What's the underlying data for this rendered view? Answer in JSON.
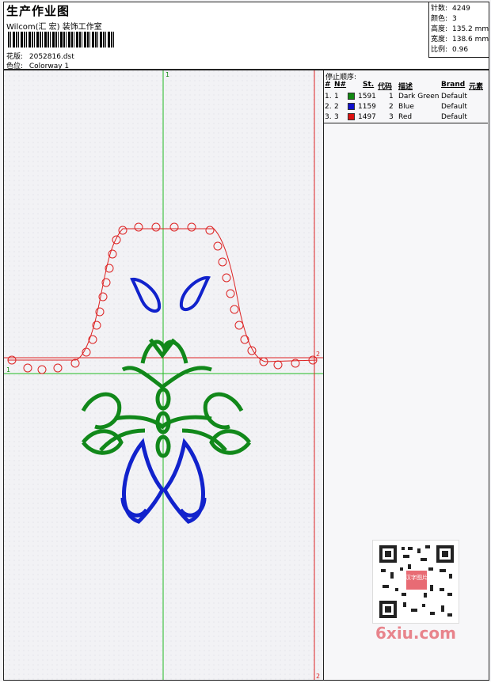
{
  "header": {
    "title": "生产作业图",
    "subtitle": "Wilcom(汇 宏) 装饰工作室",
    "design_label": "花版:",
    "design_value": "2052816.dst",
    "colorway_label": "色位:",
    "colorway_value": "Colorway 1"
  },
  "stats": [
    {
      "label": "针数:",
      "value": "4249"
    },
    {
      "label": "颜色:",
      "value": "3"
    },
    {
      "label": "高度:",
      "value": "135.2 mm"
    },
    {
      "label": "宽度:",
      "value": "138.6 mm"
    },
    {
      "label": "比例:",
      "value": "0.96"
    }
  ],
  "sequence": {
    "title": "停止顺序:",
    "columns": [
      "#",
      "N#",
      "St.",
      "代码",
      "描述",
      "Brand",
      "元素"
    ],
    "rows": [
      {
        "num": "1.",
        "n": "1",
        "color": "#118811",
        "st": "1591",
        "code": "1",
        "desc": "Dark Green",
        "brand": "Default"
      },
      {
        "num": "2.",
        "n": "2",
        "color": "#1111cc",
        "st": "1159",
        "code": "2",
        "desc": "Blue",
        "brand": "Default"
      },
      {
        "num": "3.",
        "n": "3",
        "color": "#dd1111",
        "st": "1497",
        "code": "3",
        "desc": "Red",
        "brand": "Default"
      }
    ]
  },
  "guides": {
    "green_top": "1",
    "green_left": "1",
    "red_right": "2",
    "red_bottom": "2"
  },
  "watermark": "6xiu.com",
  "qr_label": "汉字图片"
}
